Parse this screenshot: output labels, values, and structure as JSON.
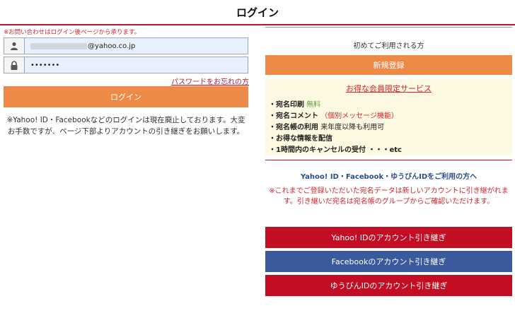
{
  "header": {
    "title": "ログイン"
  },
  "login": {
    "notice": "※お問い合わせはログイン後ページから承ります。",
    "email_visible": "@yahoo.co.jp",
    "password_masked": "•••••••",
    "forgot_link": "パスワードをお忘れの方",
    "login_button": "ログイン",
    "deprecated_text": "※Yahoo! ID・Facebookなどのログインは現在廃止しております。大変お手数ですが、ページ下部よりアカウントの引き継ぎをお願いします。"
  },
  "register": {
    "first_time_label": "初めてご利用される方",
    "register_button": "新規登録",
    "benefits_title": "お得な会員限定サービス",
    "benefits": {
      "b1_name": "・宛名印刷",
      "b1_extra": "無料",
      "b2_name": "・宛名コメント",
      "b2_extra": "（個別メッセージ機能）",
      "b3_name": "・宛名帳の利用",
      "b3_extra": "来年度以降も利用可",
      "b4_name": "・お得な情報を配信",
      "b5_name": "・1時間内のキャンセルの受付 ・・・etc"
    }
  },
  "transfer": {
    "title": "Yahoo! ID・Facebook・ゆうびんIDをご利用の方へ",
    "notice": "※これまでご登録いただいた宛名データは新しいアカウントに引き継がれます。引き継いだ宛名は宛名帳のグループからご確認いただけます。",
    "yahoo_button": "Yahoo! IDのアカウント引き継ぎ",
    "facebook_button": "Facebookのアカウント引き継ぎ",
    "yupin_button": "ゆうびんIDのアカウント引き継ぎ"
  },
  "colors": {
    "accent_orange": "#ee8a48",
    "brand_red": "#c30d23",
    "facebook_blue": "#3b5a9e",
    "benefits_bg": "#fdf8e2"
  },
  "icons": {
    "user": "user-icon",
    "lock": "lock-icon"
  }
}
